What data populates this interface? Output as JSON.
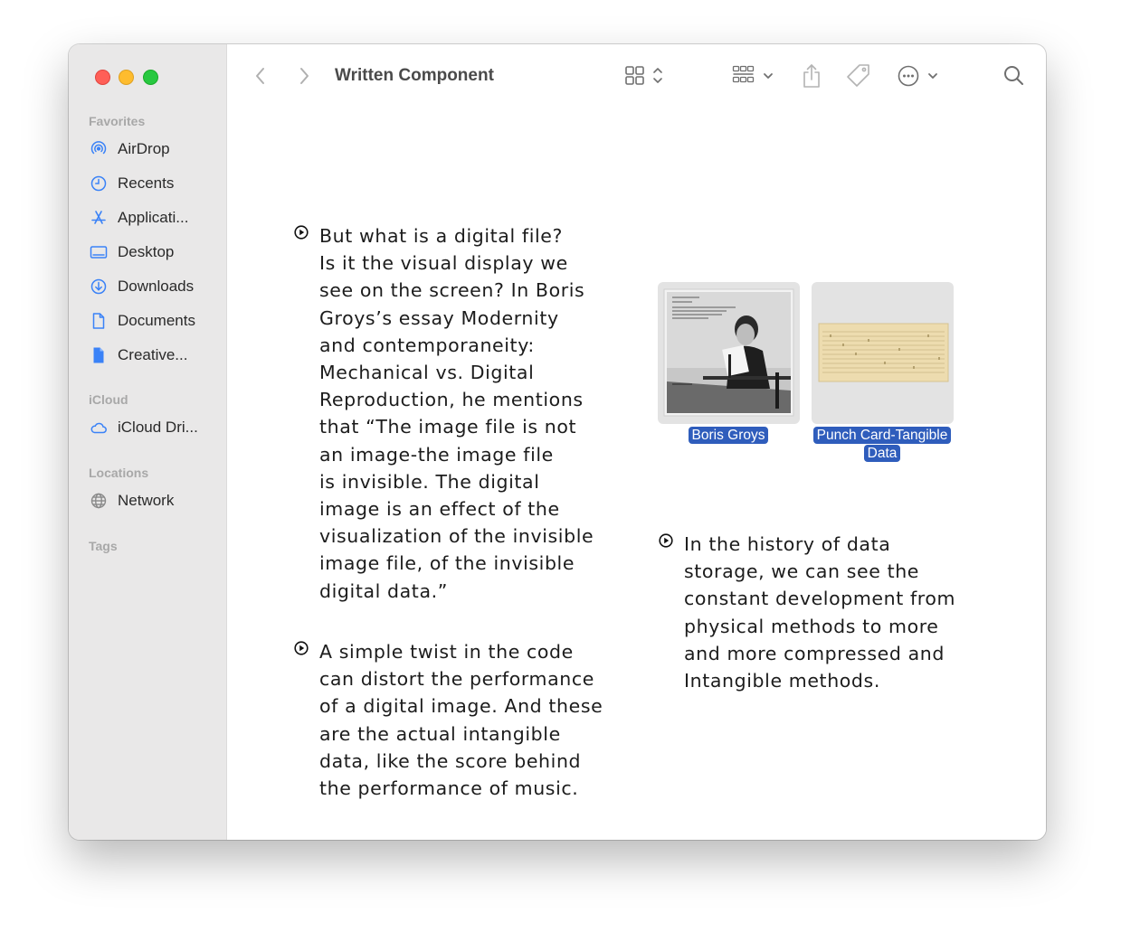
{
  "window": {
    "title": "Written Component"
  },
  "sidebar": {
    "sections": [
      {
        "title": "Favorites"
      },
      {
        "title": "iCloud"
      },
      {
        "title": "Locations"
      },
      {
        "title": "Tags"
      }
    ],
    "favorites": [
      {
        "label": "AirDrop",
        "icon": "airdrop-icon"
      },
      {
        "label": "Recents",
        "icon": "clock-icon"
      },
      {
        "label": "Applicati...",
        "icon": "applications-icon"
      },
      {
        "label": "Desktop",
        "icon": "desktop-icon"
      },
      {
        "label": "Downloads",
        "icon": "downloads-icon"
      },
      {
        "label": "Documents",
        "icon": "document-icon"
      },
      {
        "label": "Creative...",
        "icon": "file-icon"
      }
    ],
    "icloud": [
      {
        "label": "iCloud Dri...",
        "icon": "cloud-icon"
      }
    ],
    "locations": [
      {
        "label": "Network",
        "icon": "globe-icon"
      }
    ]
  },
  "content": {
    "notes": [
      {
        "text": "But what is a digital file?\nIs it the visual display we\nsee on the screen? In Boris\nGroys’s essay Modernity\nand contemporaneity:\nMechanical vs. Digital\nReproduction, he mentions\nthat “The image file is not\nan image-the image file\nis invisible. The digital\nimage is an effect of the\nvisualization of the invisible\nimage file, of the invisible\ndigital data.”"
      },
      {
        "text": "A simple twist in the code\ncan distort the performance\nof a digital image. And these\nare the actual intangible\ndata, like the score behind\nthe performance of music."
      },
      {
        "text": "In the history of data\nstorage, we can see the\nconstant development from\nphysical methods to more\nand more compressed and\nIntangible methods."
      }
    ],
    "files": [
      {
        "label": "Boris Groys"
      },
      {
        "label_line1": "Punch Card-Tangible",
        "label_line2": "Data"
      }
    ]
  },
  "colors": {
    "selection": "#2f5dbc",
    "sidebar_bg": "#e9e8e8",
    "accent_icon": "#3a82f7"
  }
}
